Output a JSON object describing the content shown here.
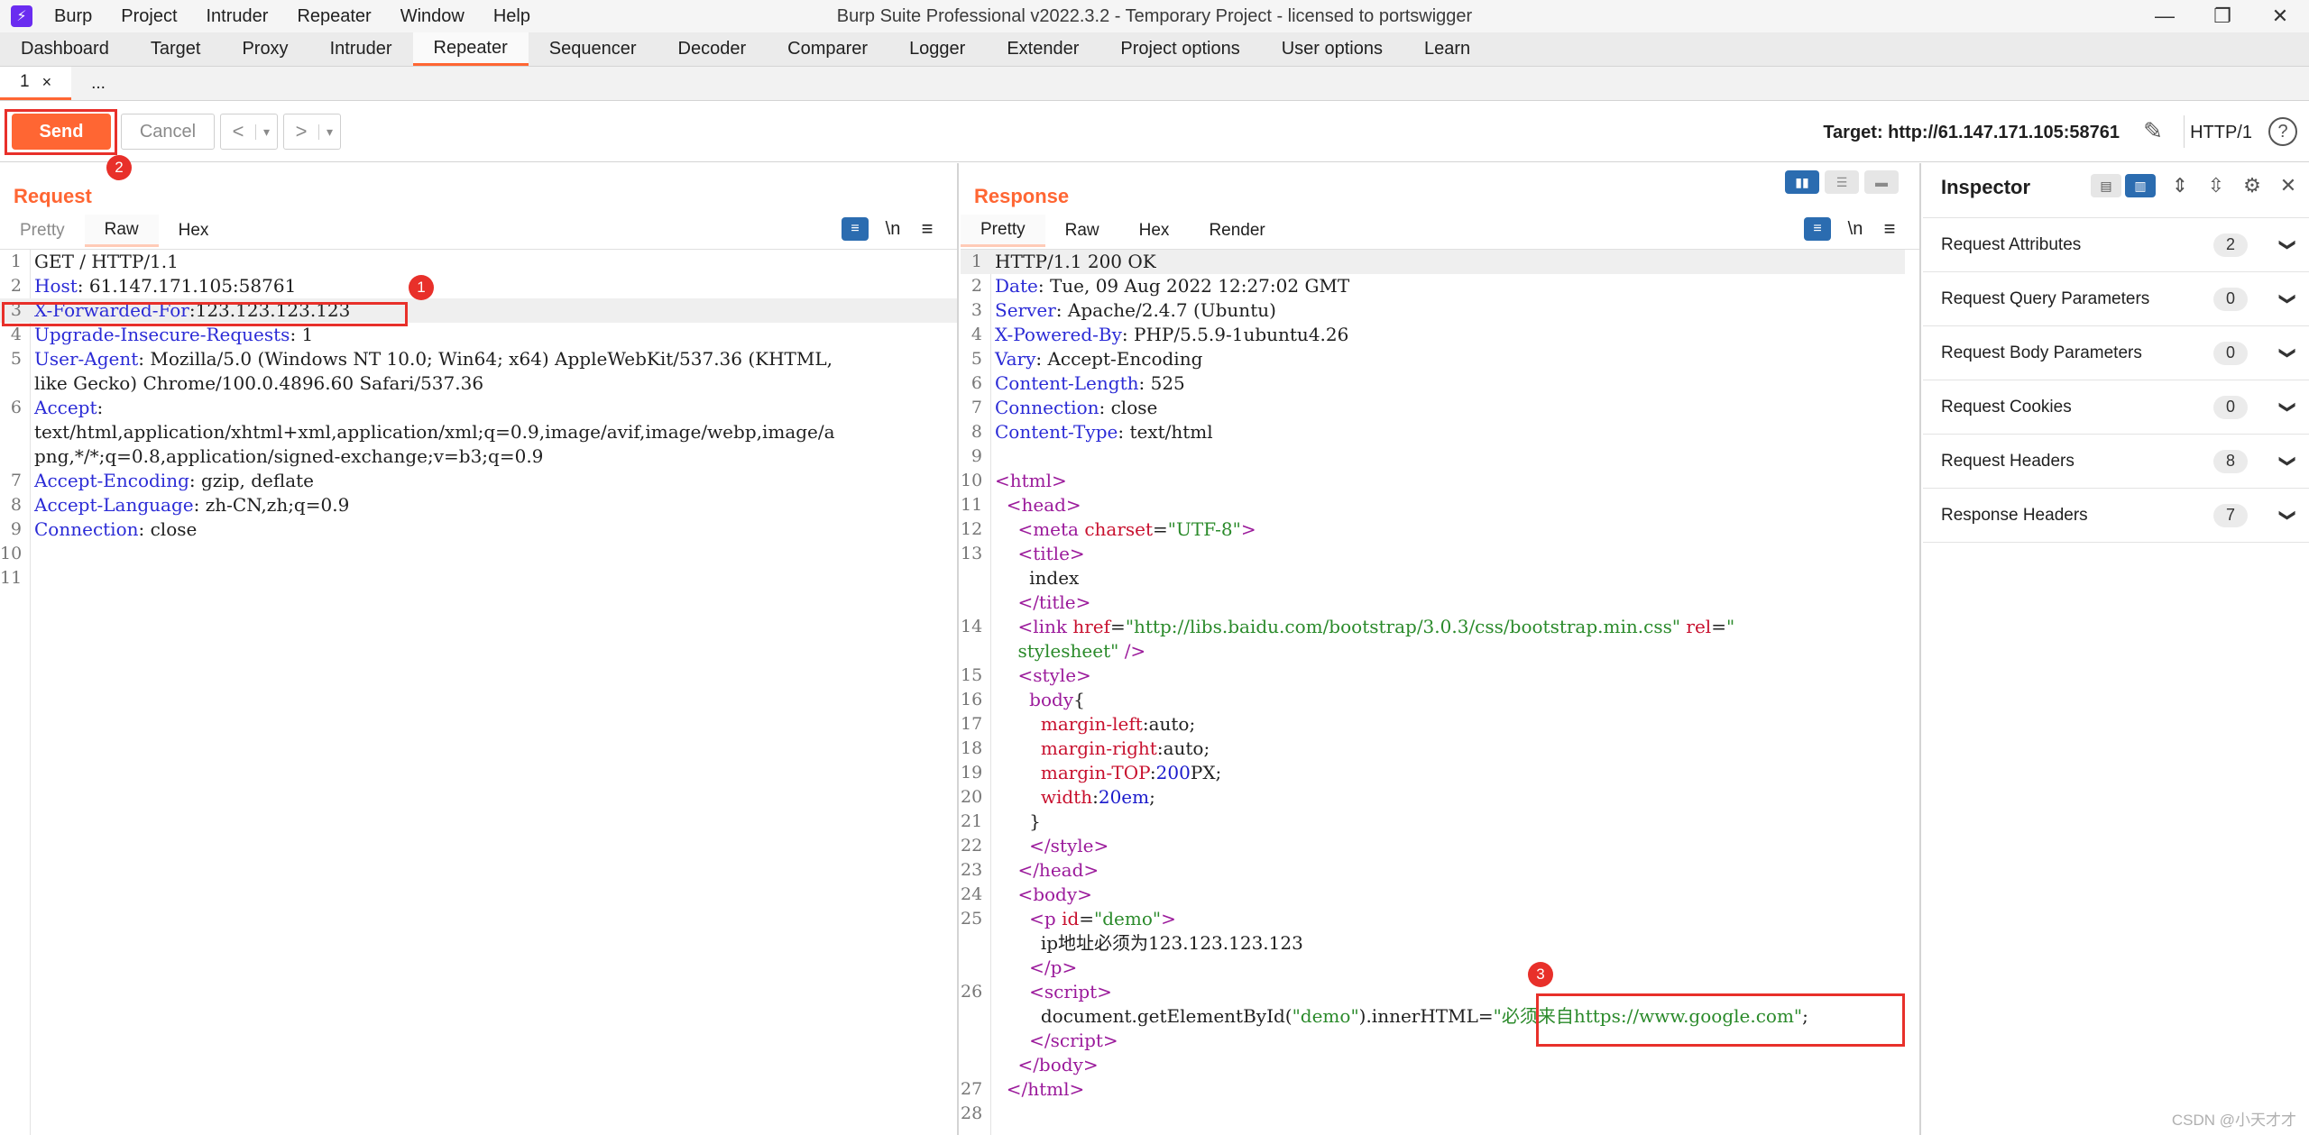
{
  "titlebar": {
    "logo": "⚡",
    "menu": [
      "Burp",
      "Project",
      "Intruder",
      "Repeater",
      "Window",
      "Help"
    ],
    "title": "Burp Suite Professional v2022.3.2 - Temporary Project - licensed to portswigger",
    "minimize": "—",
    "restore": "❐",
    "close": "✕"
  },
  "main_tabs": [
    "Dashboard",
    "Target",
    "Proxy",
    "Intruder",
    "Repeater",
    "Sequencer",
    "Decoder",
    "Comparer",
    "Logger",
    "Extender",
    "Project options",
    "User options",
    "Learn"
  ],
  "active_main_tab": "Repeater",
  "sub_tabs": {
    "tab1": "1",
    "tab1_close": "×",
    "more": "..."
  },
  "toolbar": {
    "send": "Send",
    "cancel": "Cancel",
    "prev": "<",
    "next": ">",
    "dropdown": "▾",
    "target": "Target: http://61.147.171.105:58761",
    "http_version": "HTTP/1",
    "help": "?"
  },
  "annotations": {
    "one": "1",
    "two": "2",
    "three": "3"
  },
  "request": {
    "title": "Request",
    "tabs": {
      "pretty": "Pretty",
      "raw": "Raw",
      "hex": "Hex"
    },
    "tools": {
      "newline": "\\n",
      "menu": "≡"
    }
  },
  "response": {
    "title": "Response",
    "tabs": {
      "pretty": "Pretty",
      "raw": "Raw",
      "hex": "Hex",
      "render": "Render"
    },
    "tools": {
      "newline": "\\n",
      "menu": "≡"
    }
  },
  "inspector": {
    "title": "Inspector",
    "items": [
      {
        "label": "Request Attributes",
        "count": "2"
      },
      {
        "label": "Request Query Parameters",
        "count": "0"
      },
      {
        "label": "Request Body Parameters",
        "count": "0"
      },
      {
        "label": "Request Cookies",
        "count": "0"
      },
      {
        "label": "Request Headers",
        "count": "8"
      },
      {
        "label": "Response Headers",
        "count": "7"
      }
    ]
  },
  "watermark": "CSDN @小天才才",
  "colors": {
    "accent": "#ff6633",
    "annotation": "#e8302a",
    "toggle_active": "#2b6cb0"
  },
  "icons": [
    "burp-logo-icon",
    "pencil-icon",
    "help-icon",
    "wrap-icon",
    "newline-icon",
    "hamburger-icon",
    "chevron-down-icon",
    "settings-icon",
    "close-icon",
    "expand-icon",
    "collapse-icon"
  ]
}
